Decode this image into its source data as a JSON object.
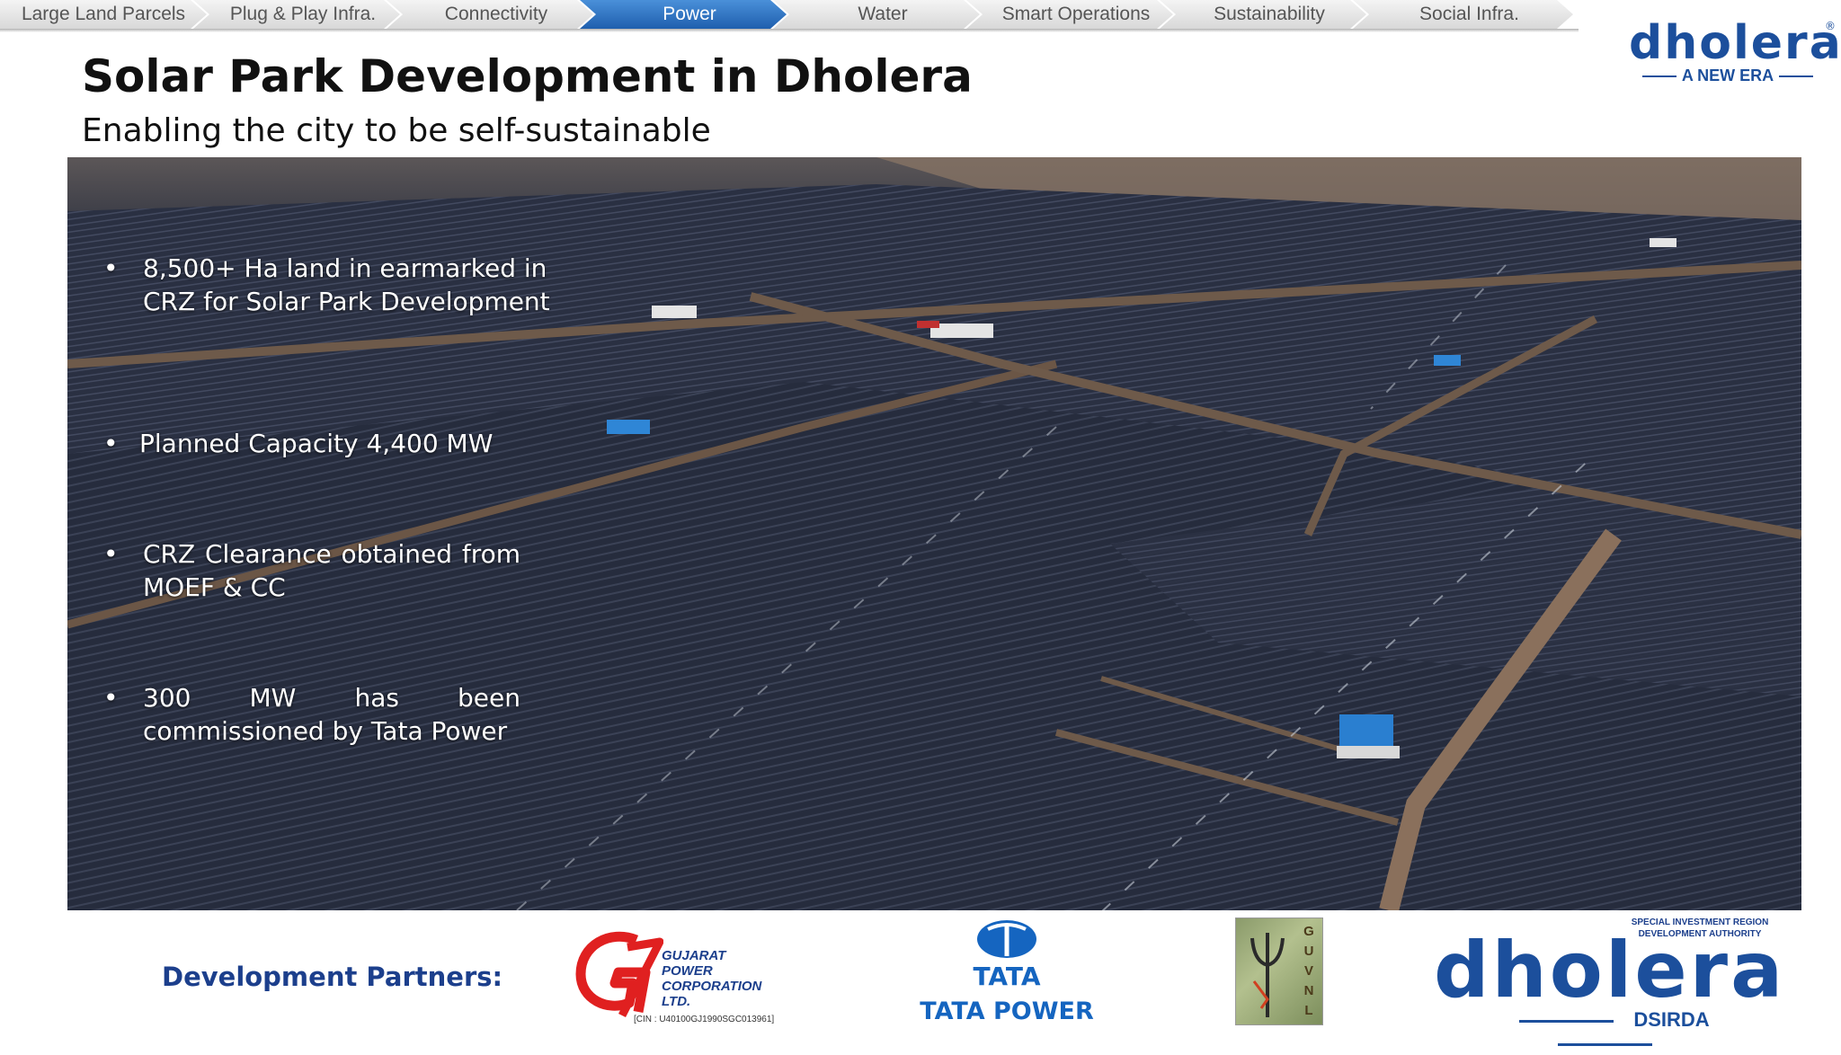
{
  "nav": {
    "tabs": [
      {
        "label": "Large Land Parcels",
        "active": false
      },
      {
        "label": "Plug & Play Infra.",
        "active": false
      },
      {
        "label": "Connectivity",
        "active": false
      },
      {
        "label": "Power",
        "active": true
      },
      {
        "label": "Water",
        "active": false
      },
      {
        "label": "Smart Operations",
        "active": false
      },
      {
        "label": "Sustainability",
        "active": false
      },
      {
        "label": "Social Infra.",
        "active": false
      }
    ]
  },
  "header": {
    "title": "Solar Park Development in Dholera",
    "subtitle": "Enabling the city to be self-sustainable"
  },
  "logo_top": {
    "word": "dholera",
    "registered": "®",
    "tagline": "A NEW ERA"
  },
  "photo": {
    "bullets": [
      {
        "marker": "•",
        "text": "8,500+ Ha land in earmarked in CRZ for Solar Park Development"
      },
      {
        "marker": "•",
        "text": "Planned Capacity 4,400 MW"
      },
      {
        "marker": "•",
        "text": "CRZ Clearance obtained from MOEF & CC"
      },
      {
        "marker": "•",
        "text": "300 MW has been commissioned by Tata Power"
      }
    ]
  },
  "partners": {
    "label": "Development Partners:",
    "gpcl": {
      "line1": "GUJARAT",
      "line2": "POWER",
      "line3": "CORPORATION",
      "line4": "LTD.",
      "cin": "[CIN : U40100GJ1990SGC013961]"
    },
    "tata": {
      "name": "TATA",
      "power": "TATA POWER"
    },
    "guvnl": {
      "letters": "G U V N L"
    },
    "dsirda": {
      "authority": "SPECIAL INVESTMENT REGION DEVELOPMENT AUTHORITY",
      "word": "dholera",
      "abbr": "DSIRDA"
    }
  },
  "colors": {
    "brand_blue": "#1c4f9c",
    "active_tab": "#2f73c6",
    "partner_label": "#1c3f8c",
    "gpcl_red": "#e02020",
    "tata_blue": "#1565c0"
  }
}
